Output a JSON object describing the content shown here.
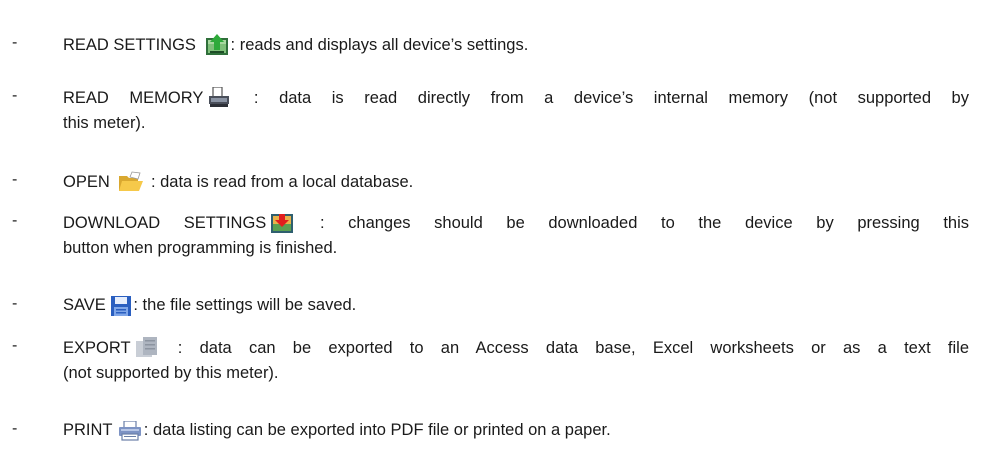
{
  "items": [
    {
      "label": "READ SETTINGS",
      "icon": "read-settings-icon",
      "desc1": ": reads and displays all device’s settings.",
      "desc2": ""
    },
    {
      "label": "READ MEMORY",
      "icon": "read-memory-icon",
      "desc1": ": data is read directly from a device’s internal memory (not supported by",
      "desc2": "this meter)."
    },
    {
      "label": "OPEN",
      "icon": "open-folder-icon",
      "desc1": " : data is read from a local database.",
      "desc2": ""
    },
    {
      "label": "DOWNLOAD SETTINGS",
      "icon": "download-settings-icon",
      "desc1": " : changes should be downloaded to the device by pressing this",
      "desc2": "button when programming is finished."
    },
    {
      "label": "SAVE",
      "icon": "save-icon",
      "desc1": ": the file settings will be saved.",
      "desc2": ""
    },
    {
      "label": "EXPORT",
      "icon": "export-icon",
      "desc1": " : data can be exported to an Access data base, Excel worksheets or as a text file",
      "desc2": "(not supported by this meter)."
    },
    {
      "label": "PRINT",
      "icon": "print-icon",
      "desc1": ": data listing can be exported into PDF file or printed on  a paper.",
      "desc2": ""
    }
  ],
  "bullet": "-"
}
